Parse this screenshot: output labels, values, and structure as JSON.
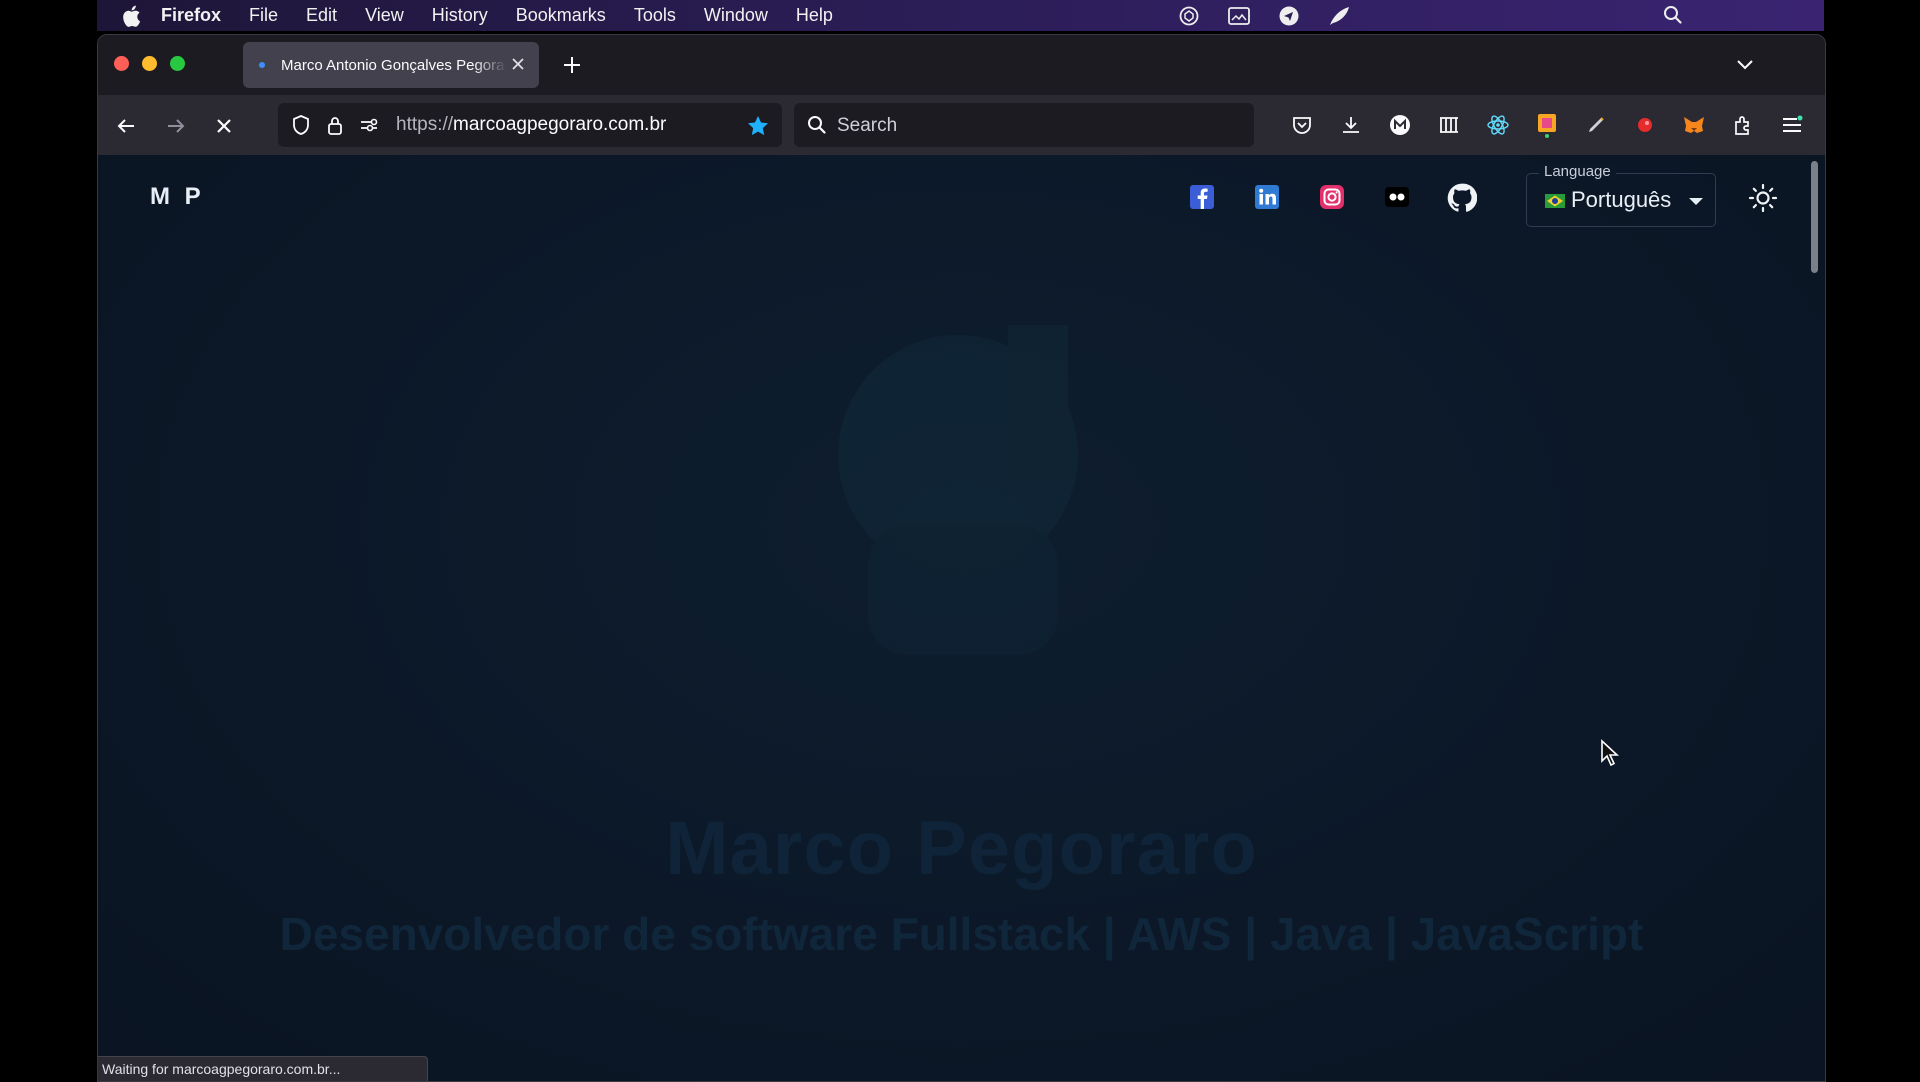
{
  "menubar": {
    "items": [
      "Firefox",
      "File",
      "Edit",
      "View",
      "History",
      "Bookmarks",
      "Tools",
      "Window",
      "Help"
    ],
    "status_icons": [
      "chatgpt-icon",
      "screen-capture-icon",
      "send-icon",
      "feather-icon"
    ],
    "spotlight_icon": "magnifier-icon"
  },
  "browser": {
    "tab_title": "Marco Antonio Gonçalves Pegoraro",
    "url_protocol": "https://",
    "url_host": "marcoagpegoraro.com.br",
    "search_placeholder": "Search",
    "toolbar_icons": [
      "pocket-icon",
      "downloads-icon",
      "extension-m-icon",
      "extension-bars-icon",
      "react-devtools-icon",
      "color-picker-icon",
      "pen-icon",
      "record-icon",
      "metamask-icon",
      "extensions-icon",
      "menu-icon"
    ],
    "status_text": "Waiting for marcoagpegoraro.com.br..."
  },
  "page": {
    "logo": "M P",
    "social": [
      "facebook-icon",
      "linkedin-icon",
      "instagram-icon",
      "flickr-icon",
      "github-icon"
    ],
    "language_label": "Language",
    "language_value": "Português",
    "hero_name": "Marco Pegoraro",
    "hero_subtitle": "Desenvolvedor de software Fullstack | AWS | Java | JavaScript"
  },
  "colors": {
    "accent": "#3d8fff",
    "page_bg": "#0c1828",
    "facebook": "#3b5dd6",
    "linkedin": "#2f7bd4",
    "instagram": "#e1306c"
  }
}
